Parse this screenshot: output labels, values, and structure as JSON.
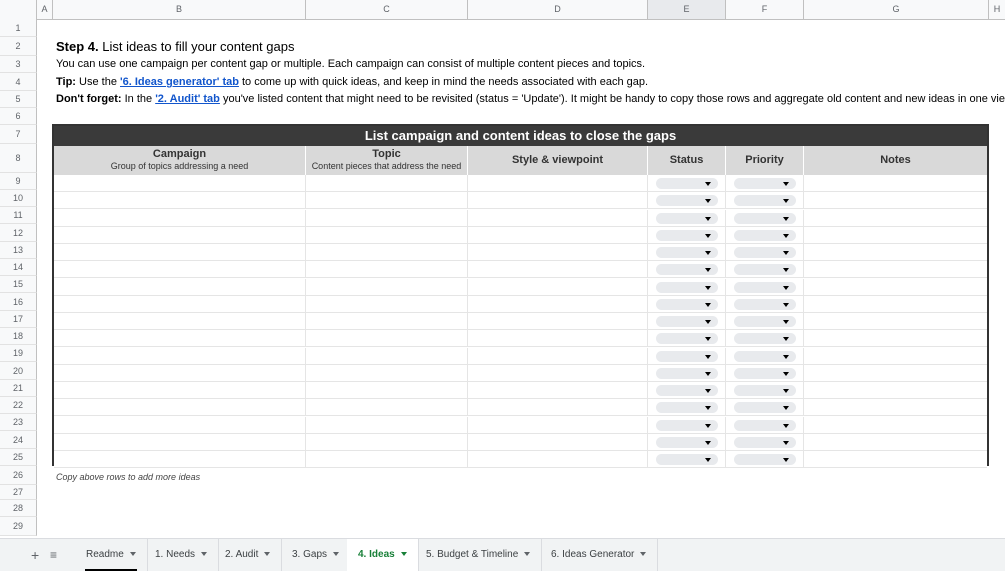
{
  "columns": [
    "A",
    "B",
    "C",
    "D",
    "E",
    "F",
    "G",
    "H"
  ],
  "rows": [
    "1",
    "2",
    "3",
    "4",
    "5",
    "6",
    "7",
    "8",
    "9",
    "10",
    "11",
    "12",
    "13",
    "14",
    "15",
    "16",
    "17",
    "18",
    "19",
    "20",
    "21",
    "22",
    "23",
    "24",
    "25",
    "26",
    "27",
    "28",
    "29"
  ],
  "step": {
    "label": "Step 4.",
    "title": " List ideas to fill your content gaps",
    "intro": "You can use one campaign per content gap or multiple. Each campaign can consist of multiple content pieces and topics.",
    "tip_label": "Tip:",
    "tip_pre": " Use the ",
    "tip_link": "'6. Ideas generator' tab",
    "tip_post": " to come up with quick ideas, and keep in mind the needs associated with each gap.",
    "dont_label": "Don't forget:",
    "dont_pre": " In the ",
    "dont_link": "'2. Audit' tab",
    "dont_post": " you've listed content that might need to be revisited (status = 'Update'). It might be handy to copy those rows and aggregate old content and new ideas in one view."
  },
  "table": {
    "title": "List campaign and content ideas to close the gaps",
    "headers": {
      "campaign": "Campaign",
      "campaign_sub": "Group of topics addressing a need",
      "topic": "Topic",
      "topic_sub": "Content pieces that address the need",
      "style": "Style & viewpoint",
      "status": "Status",
      "priority": "Priority",
      "notes": "Notes"
    },
    "row_count": 17
  },
  "note": "Copy above rows to add more ideas",
  "tabs": [
    {
      "label": "Readme"
    },
    {
      "label": "1. Needs"
    },
    {
      "label": "2. Audit"
    },
    {
      "label": "3. Gaps"
    },
    {
      "label": "4. Ideas"
    },
    {
      "label": "5. Budget & Timeline"
    },
    {
      "label": "6. Ideas Generator"
    }
  ],
  "active_tab": "4. Ideas",
  "colors": {
    "active_tab": "#188038",
    "link": "#1155cc",
    "table_title_bg": "#3a3a3a",
    "header_bg": "#d9d9d9"
  }
}
